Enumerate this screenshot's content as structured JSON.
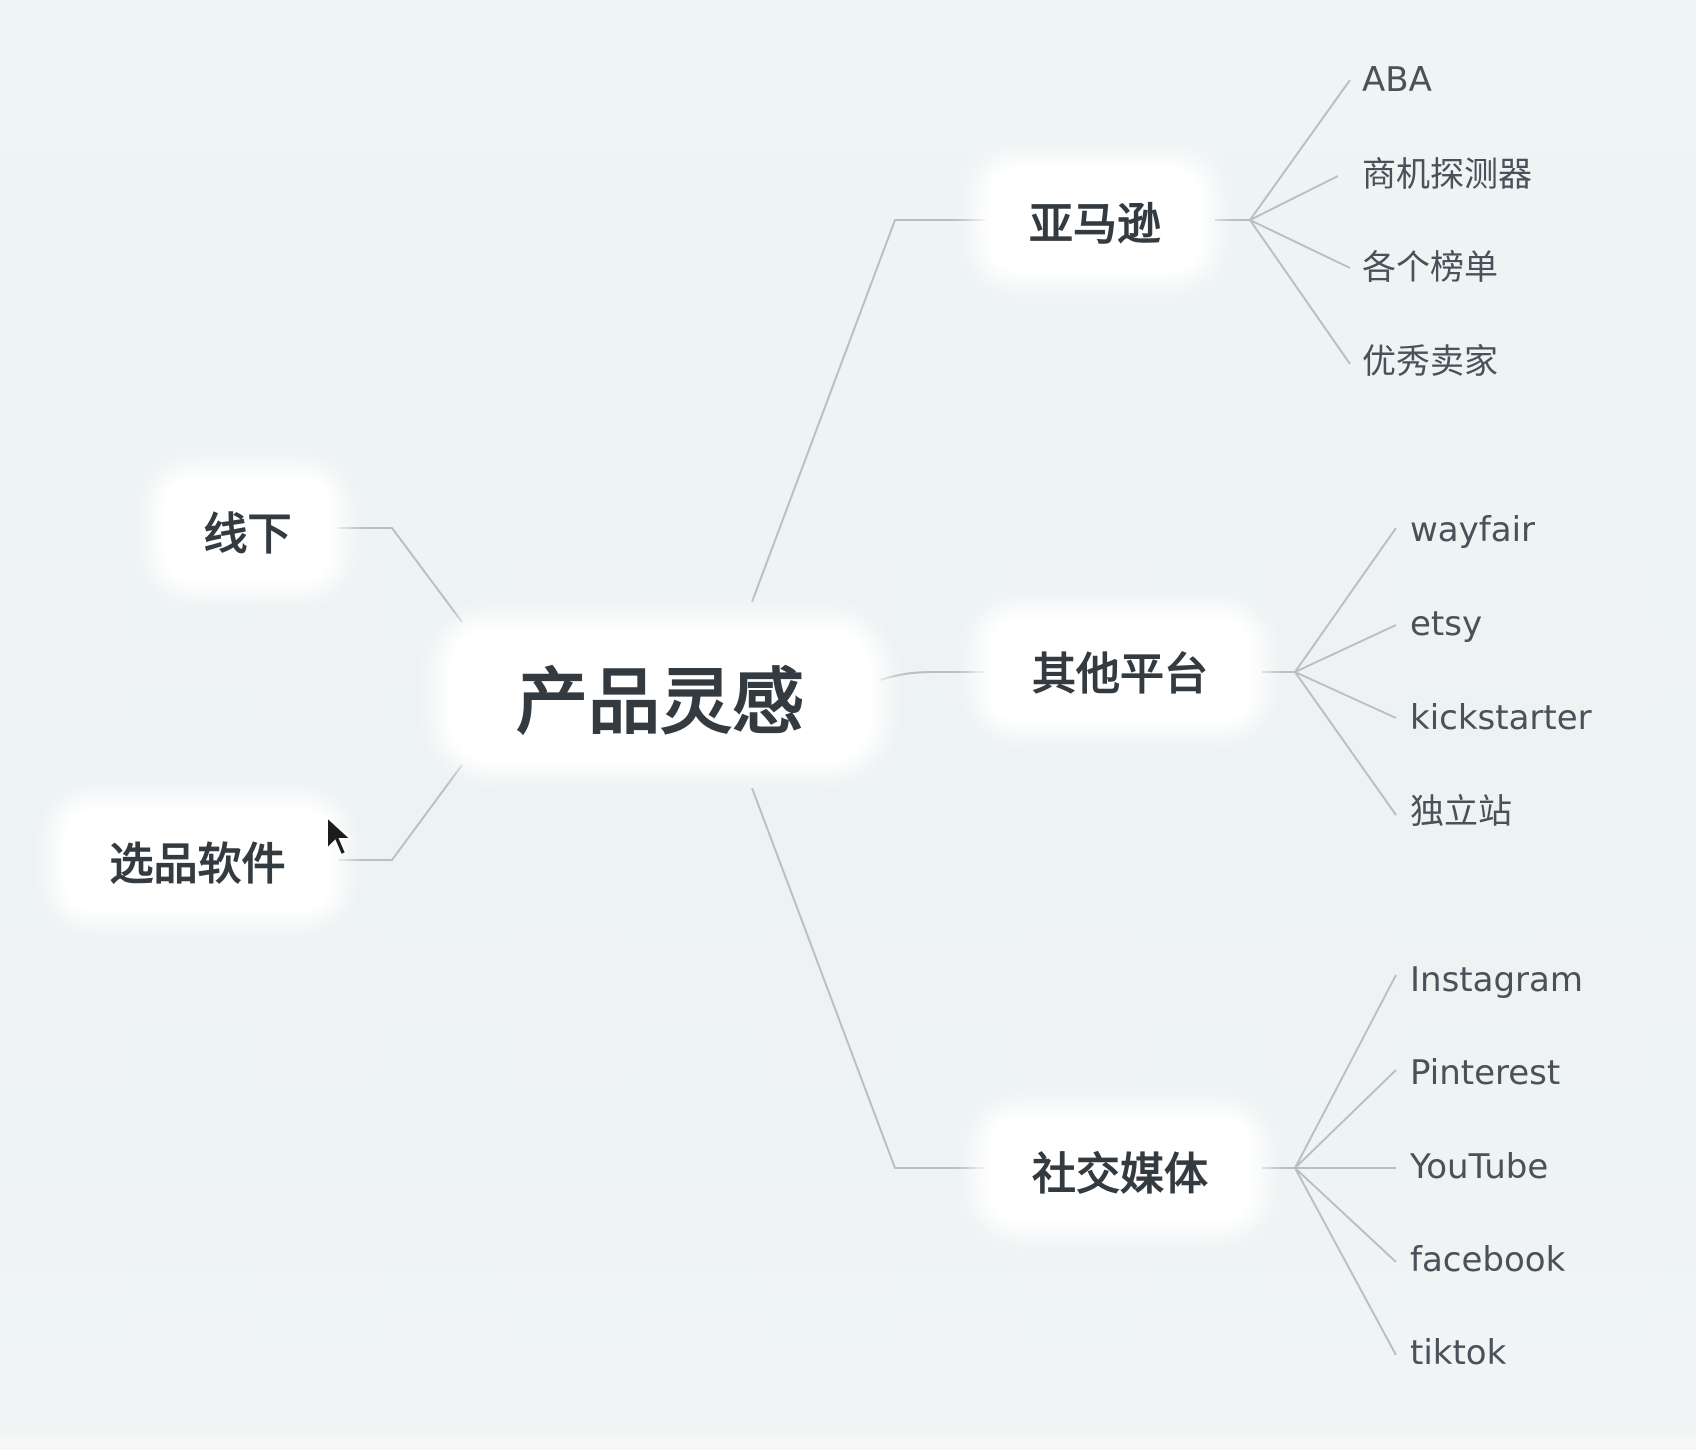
{
  "mindmap": {
    "central": "产品灵感",
    "branches": [
      {
        "label": "亚马逊",
        "children": [
          "ABA",
          "商机探测器",
          "各个榜单",
          "优秀卖家"
        ]
      },
      {
        "label": "其他平台",
        "children": [
          "wayfair",
          "etsy",
          "kickstarter",
          "独立站"
        ]
      },
      {
        "label": "社交媒体",
        "children": [
          "Instagram",
          "Pinterest",
          "YouTube",
          "facebook",
          "tiktok"
        ]
      },
      {
        "label": "线下",
        "children": []
      },
      {
        "label": "选品软件",
        "children": []
      }
    ]
  },
  "colors": {
    "background": "#eef3f3",
    "node_fill": "#ffffff",
    "line": "#b9bfc1",
    "text_dark": "#333a40",
    "text_leaf": "#4a5158"
  },
  "icons": [
    "mouse-pointer-icon"
  ]
}
